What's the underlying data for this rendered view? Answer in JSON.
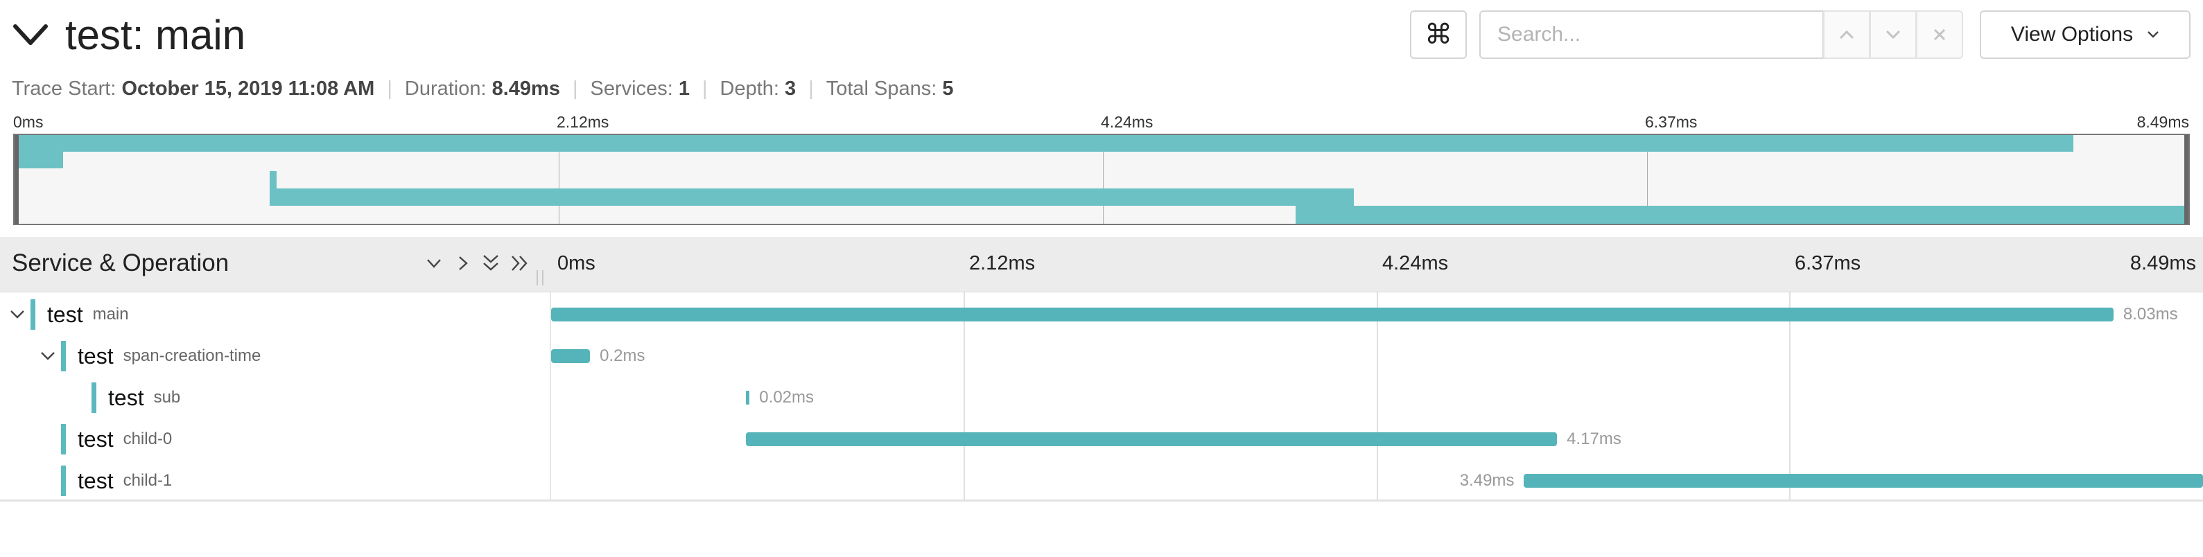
{
  "header": {
    "title": "test: main",
    "collapse_icon": "chevron-down-icon",
    "keyboard_shortcut_icon": "⌘",
    "search_placeholder": "Search...",
    "prev_icon": "chevron-up-icon",
    "next_icon": "chevron-down-icon",
    "clear_icon": "close-icon",
    "view_options_label": "View Options"
  },
  "meta": {
    "trace_start_label": "Trace Start:",
    "trace_start_value": "October 15, 2019 11:08 AM",
    "duration_label": "Duration:",
    "duration_value": "8.49ms",
    "services_label": "Services:",
    "services_value": "1",
    "depth_label": "Depth:",
    "depth_value": "3",
    "total_spans_label": "Total Spans:",
    "total_spans_value": "5"
  },
  "minimap": {
    "ticks": [
      "0ms",
      "2.12ms",
      "4.24ms",
      "6.37ms",
      "8.49ms"
    ]
  },
  "timeline": {
    "column_title": "Service & Operation",
    "ticks": [
      "0ms",
      "2.12ms",
      "4.24ms",
      "6.37ms",
      "8.49ms"
    ],
    "total_ms": 8.49,
    "spans": [
      {
        "service": "test",
        "operation": "main",
        "start_ms": 0.0,
        "duration_ms": 8.03,
        "duration_label": "8.03ms",
        "depth": 0,
        "collapsible": true,
        "label_side": "right"
      },
      {
        "service": "test",
        "operation": "span-creation-time",
        "start_ms": 0.0,
        "duration_ms": 0.2,
        "duration_label": "0.2ms",
        "depth": 1,
        "collapsible": true,
        "label_side": "right"
      },
      {
        "service": "test",
        "operation": "sub",
        "start_ms": 1.0,
        "duration_ms": 0.02,
        "duration_label": "0.02ms",
        "depth": 2,
        "collapsible": false,
        "label_side": "right"
      },
      {
        "service": "test",
        "operation": "child-0",
        "start_ms": 1.0,
        "duration_ms": 4.17,
        "duration_label": "4.17ms",
        "depth": 1,
        "collapsible": false,
        "label_side": "right"
      },
      {
        "service": "test",
        "operation": "child-1",
        "start_ms": 5.0,
        "duration_ms": 3.49,
        "duration_label": "3.49ms",
        "depth": 1,
        "collapsible": false,
        "label_side": "left"
      }
    ]
  },
  "colors": {
    "span": "#55b4b9",
    "minimap_span": "#6cc1c4",
    "service_marker": "#5bb9bf"
  }
}
